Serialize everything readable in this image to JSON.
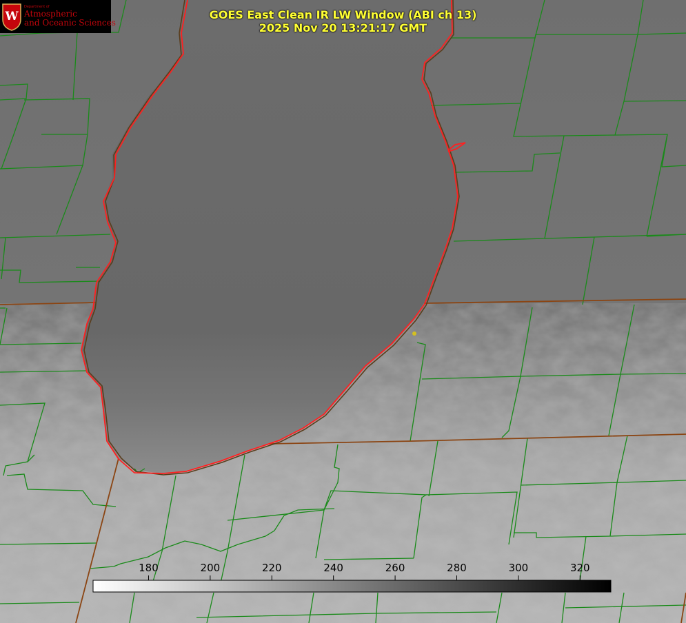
{
  "header": {
    "title_line1": "GOES East Clean IR LW Window (ABI ch 13)",
    "title_line2": "2025 Nov 20 13:21:17 GMT"
  },
  "logo": {
    "dept": "Department of",
    "line1": "Atmospheric",
    "line2": "and Oceanic Sciences",
    "initial": "W",
    "color": "#c5050c"
  },
  "map": {
    "lake_outline_color": "#ff2020",
    "county_border_color": "#1a8a1a",
    "state_border_color": "#8b4513",
    "marker_color": "#d4c020"
  },
  "colorbar": {
    "ticks": [
      180,
      200,
      220,
      240,
      260,
      280,
      300,
      320
    ],
    "tick_labels": [
      "180",
      "200",
      "220",
      "240",
      "260",
      "280",
      "300",
      "320"
    ],
    "vmin": 162,
    "vmax": 330,
    "gradient": "white-to-black"
  }
}
